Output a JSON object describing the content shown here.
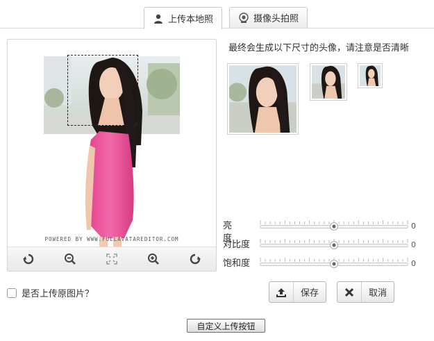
{
  "tabs": [
    {
      "label": "上传本地照",
      "icon": "user-icon",
      "active": true
    },
    {
      "label": "摄像头拍照",
      "icon": "webcam-icon",
      "active": false
    }
  ],
  "preview": {
    "watermark": "POWERED BY WWW.FULLAVATAREDITOR.COM",
    "tools": [
      {
        "name": "rotate-left-icon"
      },
      {
        "name": "zoom-out-icon"
      },
      {
        "name": "fit-icon"
      },
      {
        "name": "zoom-in-icon"
      },
      {
        "name": "rotate-right-icon"
      }
    ]
  },
  "hint": "最终会生成以下尺寸的头像，请注意是否清晰",
  "sliders": [
    {
      "label": "亮 度",
      "value": "0",
      "position": 0.5
    },
    {
      "label": "对比度",
      "value": "0",
      "position": 0.5
    },
    {
      "label": "饱和度",
      "value": "0",
      "position": 0.5
    }
  ],
  "checkbox": {
    "label": "是否上传原图片？",
    "checked": false
  },
  "buttons": {
    "save": "保存",
    "cancel": "取消",
    "custom_upload": "自定义上传按钮"
  },
  "colors": {
    "dress": "#ee5b9f",
    "hair": "#1c1412",
    "skin": "#f2cdb7",
    "background": "#d9e4ea"
  }
}
